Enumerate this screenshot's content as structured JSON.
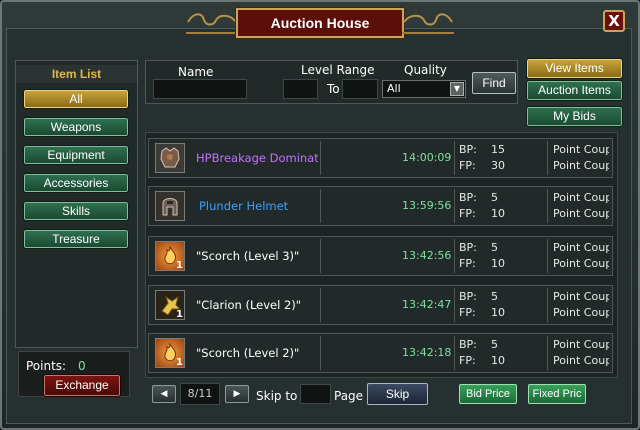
{
  "window": {
    "title": "Auction House",
    "close_label": "X"
  },
  "sidebar": {
    "title": "Item List",
    "items": [
      {
        "label": "All",
        "active": true
      },
      {
        "label": "Weapons"
      },
      {
        "label": "Equipment"
      },
      {
        "label": "Accessories"
      },
      {
        "label": "Skills"
      },
      {
        "label": "Treasure"
      }
    ],
    "points_label": "Points:",
    "points_value": "0",
    "exchange_label": "Exchange"
  },
  "search": {
    "name_label": "Name",
    "level_range_label": "Level Range",
    "to_label": "To",
    "quality_label": "Quality",
    "quality_value": "All",
    "find_label": "Find"
  },
  "nav": {
    "view_items": "View Items",
    "auction_items": "Auction Items",
    "my_bids": "My Bids"
  },
  "items": [
    {
      "name": "HPBreakage Dominato",
      "name_color": "#c070ff",
      "time": "14:00:09",
      "bp_label": "BP:",
      "bp": "15",
      "fp_label": "FP:",
      "fp": "30",
      "currency": "Point Coup",
      "icon": "armor-icon",
      "qty": ""
    },
    {
      "name": "Plunder Helmet",
      "name_color": "#3aa0ff",
      "time": "13:59:56",
      "bp_label": "BP:",
      "bp": "5",
      "fp_label": "FP:",
      "fp": "10",
      "currency": "Point Coup",
      "icon": "helmet-icon",
      "qty": ""
    },
    {
      "name": "\"Scorch (Level 3)\"",
      "name_color": "#ffffff",
      "time": "13:42:56",
      "bp_label": "BP:",
      "bp": "5",
      "fp_label": "FP:",
      "fp": "10",
      "currency": "Point Coup",
      "icon": "scorch-skill-icon",
      "qty": "1"
    },
    {
      "name": "\"Clarion (Level 2)\"",
      "name_color": "#ffffff",
      "time": "13:42:47",
      "bp_label": "BP:",
      "bp": "5",
      "fp_label": "FP:",
      "fp": "10",
      "currency": "Point Coup",
      "icon": "clarion-skill-icon",
      "qty": "1"
    },
    {
      "name": "\"Scorch (Level 2)\"",
      "name_color": "#ffffff",
      "time": "13:42:18",
      "bp_label": "BP:",
      "bp": "5",
      "fp_label": "FP:",
      "fp": "10",
      "currency": "Point Coup",
      "icon": "scorch-skill-icon",
      "qty": "1"
    }
  ],
  "pagination": {
    "prev_label": "◀",
    "next_label": "▶",
    "page_value": "8/11",
    "skip_to_label": "Skip to",
    "page_label": "Page",
    "skip_label": "Skip"
  },
  "actions": {
    "bid_price": "Bid Price",
    "fixed_price": "Fixed Pric"
  }
}
